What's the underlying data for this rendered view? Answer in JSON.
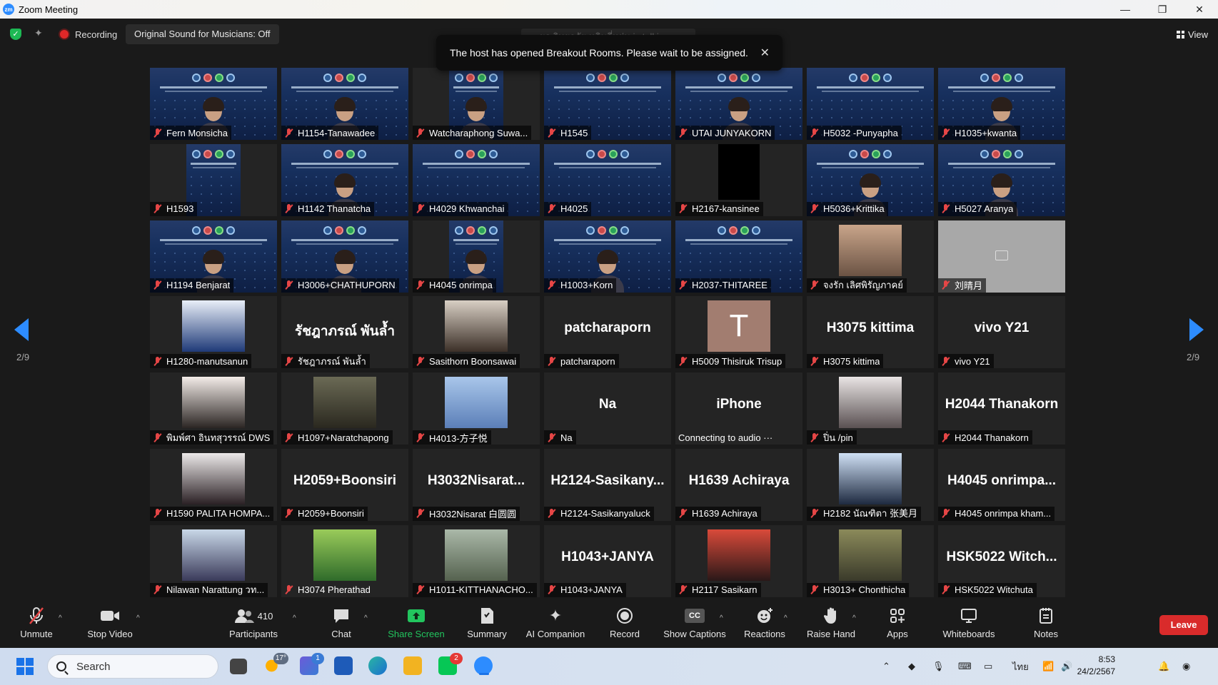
{
  "window": {
    "title": "Zoom Meeting",
    "minimize": "—",
    "restore": "❐",
    "close": "✕"
  },
  "topbar": {
    "recording_label": "Recording",
    "original_sound": "Original Sound for Musicians: Off",
    "speaker_ghost": "ผอ.วิทยาลัย หลิมลี่หยุ่น is talking...",
    "view_label": "View"
  },
  "notice": {
    "text": "The host has opened Breakout Rooms. Please wait to be assigned.",
    "close": "✕"
  },
  "nav": {
    "left_page": "2/9",
    "right_page": "2/9"
  },
  "tiles": [
    {
      "kind": "slide-person",
      "label": "Fern Monsicha"
    },
    {
      "kind": "slide-person",
      "label": "H1154-Tanawadee"
    },
    {
      "kind": "slide-narrow-person",
      "label": "Watcharaphong Suwa..."
    },
    {
      "kind": "slide",
      "label": "H1545"
    },
    {
      "kind": "slide-person",
      "label": "UTAI  JUNYAKORN"
    },
    {
      "kind": "slide",
      "label": "H5032 -Punyapha"
    },
    {
      "kind": "slide-person",
      "label": "H1035+kwanta"
    },
    {
      "kind": "slide-narrow",
      "label": "H1593"
    },
    {
      "kind": "slide-person",
      "label": "H1142 Thanatcha"
    },
    {
      "kind": "slide",
      "label": "H4029 Khwanchai"
    },
    {
      "kind": "slide",
      "label": "H4025"
    },
    {
      "kind": "black",
      "label": "H2167-kansinee"
    },
    {
      "kind": "slide-person",
      "label": "H5036+Krittika"
    },
    {
      "kind": "slide-person",
      "label": "H5027 Aranya"
    },
    {
      "kind": "slide-person",
      "label": "H1194 Benjarat"
    },
    {
      "kind": "slide-person",
      "label": "H3006+CHATHUPORN"
    },
    {
      "kind": "slide-narrow-person",
      "label": "H4045 onrimpa"
    },
    {
      "kind": "slide-person",
      "label": "H1003+Korn"
    },
    {
      "kind": "slide",
      "label": "H2037-THITAREE"
    },
    {
      "kind": "photo",
      "label": "จงรัก เลิศพิรัญภาคย์",
      "c1": "#c9a58a",
      "c2": "#6b5344"
    },
    {
      "kind": "gray",
      "label": "刘晴月"
    },
    {
      "kind": "photo",
      "label": "H1280-manutsanun",
      "c1": "#e8eef8",
      "c2": "#1f3a78"
    },
    {
      "kind": "name",
      "big": "รัชฎาภรณ์ พันล้ำ",
      "label": "รัชฎาภรณ์ พันล้ำ"
    },
    {
      "kind": "photo",
      "label": "Sasithorn Boonsawai",
      "c1": "#d8cfc4",
      "c2": "#3c3028"
    },
    {
      "kind": "name",
      "big": "patcharaporn",
      "label": "patcharaporn"
    },
    {
      "kind": "avatar",
      "big": "T",
      "label": "H5009 Thisiruk Trisup"
    },
    {
      "kind": "name",
      "big": "H3075 kittima",
      "label": "H3075 kittima"
    },
    {
      "kind": "name",
      "big": "vivo Y21",
      "label": "vivo Y21"
    },
    {
      "kind": "photo",
      "label": "พิมพ์ศา อินทสุวรรณ์ DWS",
      "c1": "#f3ece8",
      "c2": "#2b2523"
    },
    {
      "kind": "photo",
      "label": "H1097+Naratchapong",
      "c1": "#6b6a55",
      "c2": "#2a281f"
    },
    {
      "kind": "photo",
      "label": "H4013-方子悦",
      "c1": "#a9c6ea",
      "c2": "#5b7fb8"
    },
    {
      "kind": "name",
      "big": "Na",
      "label": "Na"
    },
    {
      "kind": "name-plain",
      "big": "iPhone",
      "label": "Connecting to audio ···"
    },
    {
      "kind": "photo",
      "label": "ปิ่น /pin",
      "c1": "#e9e4e4",
      "c2": "#5a5152"
    },
    {
      "kind": "name",
      "big": "H2044 Thanakorn",
      "label": "H2044 Thanakorn"
    },
    {
      "kind": "photo",
      "label": "H1590 PALITA HOMPA...",
      "c1": "#ece9e9",
      "c2": "#2a2024"
    },
    {
      "kind": "name",
      "big": "H2059+Boonsiri",
      "label": "H2059+Boonsiri"
    },
    {
      "kind": "name",
      "big": "H3032Nisarat...",
      "label": "H3032Nisarat 白圆圆"
    },
    {
      "kind": "name",
      "big": "H2124-Sasikany...",
      "label": "H2124-Sasikanyaluck"
    },
    {
      "kind": "name",
      "big": "H1639 Achiraya",
      "label": "H1639 Achiraya"
    },
    {
      "kind": "photo",
      "label": "H2182 นัณฑิตา 张美月",
      "c1": "#cfe0f5",
      "c2": "#1e2a40"
    },
    {
      "kind": "name",
      "big": "H4045 onrimpa...",
      "label": "H4045 onrimpa kham..."
    },
    {
      "kind": "photo",
      "label": "Nilawan Narattung วท...",
      "c1": "#c9d8e8",
      "c2": "#3a3a5a"
    },
    {
      "kind": "photo-plain",
      "label": "H3074 Pherathad",
      "c1": "#9acb5a",
      "c2": "#2f6b2a"
    },
    {
      "kind": "photo",
      "label": "H1011-KITTHANACHO...",
      "c1": "#aab8a8",
      "c2": "#55624f"
    },
    {
      "kind": "name",
      "big": "H1043+JANYA",
      "label": "H1043+JANYA"
    },
    {
      "kind": "photo",
      "label": "H2117 Sasikarn",
      "c1": "#d94a3a",
      "c2": "#2a1818"
    },
    {
      "kind": "photo",
      "label": "H3013+ Chonthicha",
      "c1": "#8b8a5a",
      "c2": "#3a3a2a"
    },
    {
      "kind": "name",
      "big": "HSK5022  Witch...",
      "label": "HSK5022 Witchuta"
    }
  ],
  "toolbar": {
    "unmute": "Unmute",
    "stop_video": "Stop Video",
    "participants": "Participants",
    "participants_count": "410",
    "chat": "Chat",
    "share_screen": "Share Screen",
    "summary": "Summary",
    "ai_companion": "AI Companion",
    "record": "Record",
    "show_captions": "Show Captions",
    "captions_icon_text": "CC",
    "reactions": "Reactions",
    "raise_hand": "Raise Hand",
    "apps": "Apps",
    "whiteboards": "Whiteboards",
    "notes": "Notes",
    "leave": "Leave"
  },
  "taskbar": {
    "search_text": "Search",
    "weather_badge": "17°",
    "teams_badge": "1",
    "lang": "ไทย",
    "time": "8:53",
    "date": "24/2/2567",
    "chat_badge": "2"
  }
}
